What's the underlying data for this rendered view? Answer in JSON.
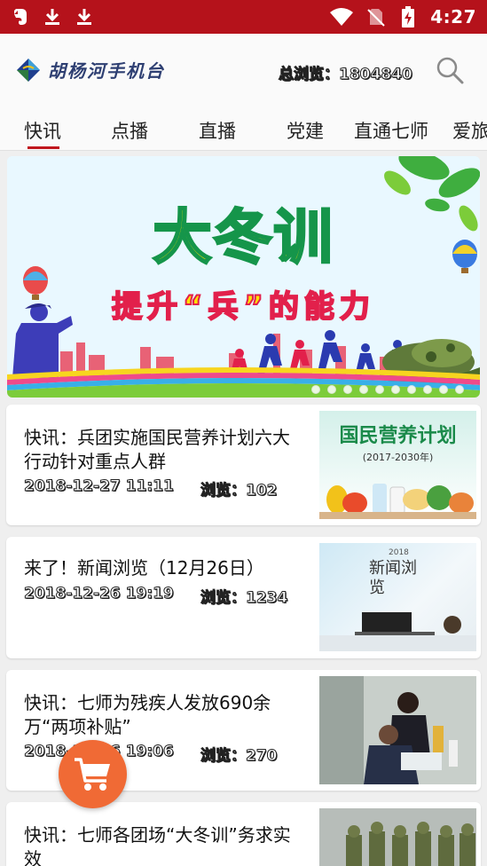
{
  "status_bar": {
    "time": "4:27",
    "left_icons": [
      "evernote-icon",
      "download-icon",
      "download-icon"
    ],
    "right_icons": [
      "wifi-icon",
      "no-sim-icon",
      "battery-charging-icon"
    ],
    "background": "#b5121b"
  },
  "header": {
    "logo_text": "胡杨河手机台",
    "total_views": "总浏览：1804840",
    "search_icon": "search-icon"
  },
  "tabs": [
    {
      "label": "快讯",
      "active": true
    },
    {
      "label": "点播"
    },
    {
      "label": "直播"
    },
    {
      "label": "党建"
    },
    {
      "label": "直通七师"
    },
    {
      "label": "爱旅"
    }
  ],
  "banner": {
    "title": "大冬训",
    "subtitle": "提升“兵”的能力",
    "slide_count": 10,
    "active_slide": 0
  },
  "news": [
    {
      "title": "快讯：兵团实施国民营养计划六大行动针对重点人群",
      "date": "2018-12-27 11:11",
      "views": "浏览：102",
      "thumb": {
        "heading": "国民营养计划",
        "years": "(2017-2030年)"
      }
    },
    {
      "title": "来了！新闻浏览（12月26日）",
      "date": "2018-12-26 19:19",
      "views": "浏览：1234",
      "thumb": {
        "heading": "新闻浏览",
        "years": "2018"
      }
    },
    {
      "title": "快讯：七师为残疾人发放690余万“两项补贴”",
      "date": "2018-12-26 19:06",
      "views": "浏览：270",
      "thumb": {}
    },
    {
      "title": "快讯：七师各团场“大冬训”务求实效",
      "date": "",
      "views": "",
      "thumb": {}
    }
  ],
  "fab_icon": "shopping-cart-icon",
  "colors": {
    "accent": "#c0161d",
    "fab": "#f06a35",
    "logo": "#2e3f72"
  }
}
